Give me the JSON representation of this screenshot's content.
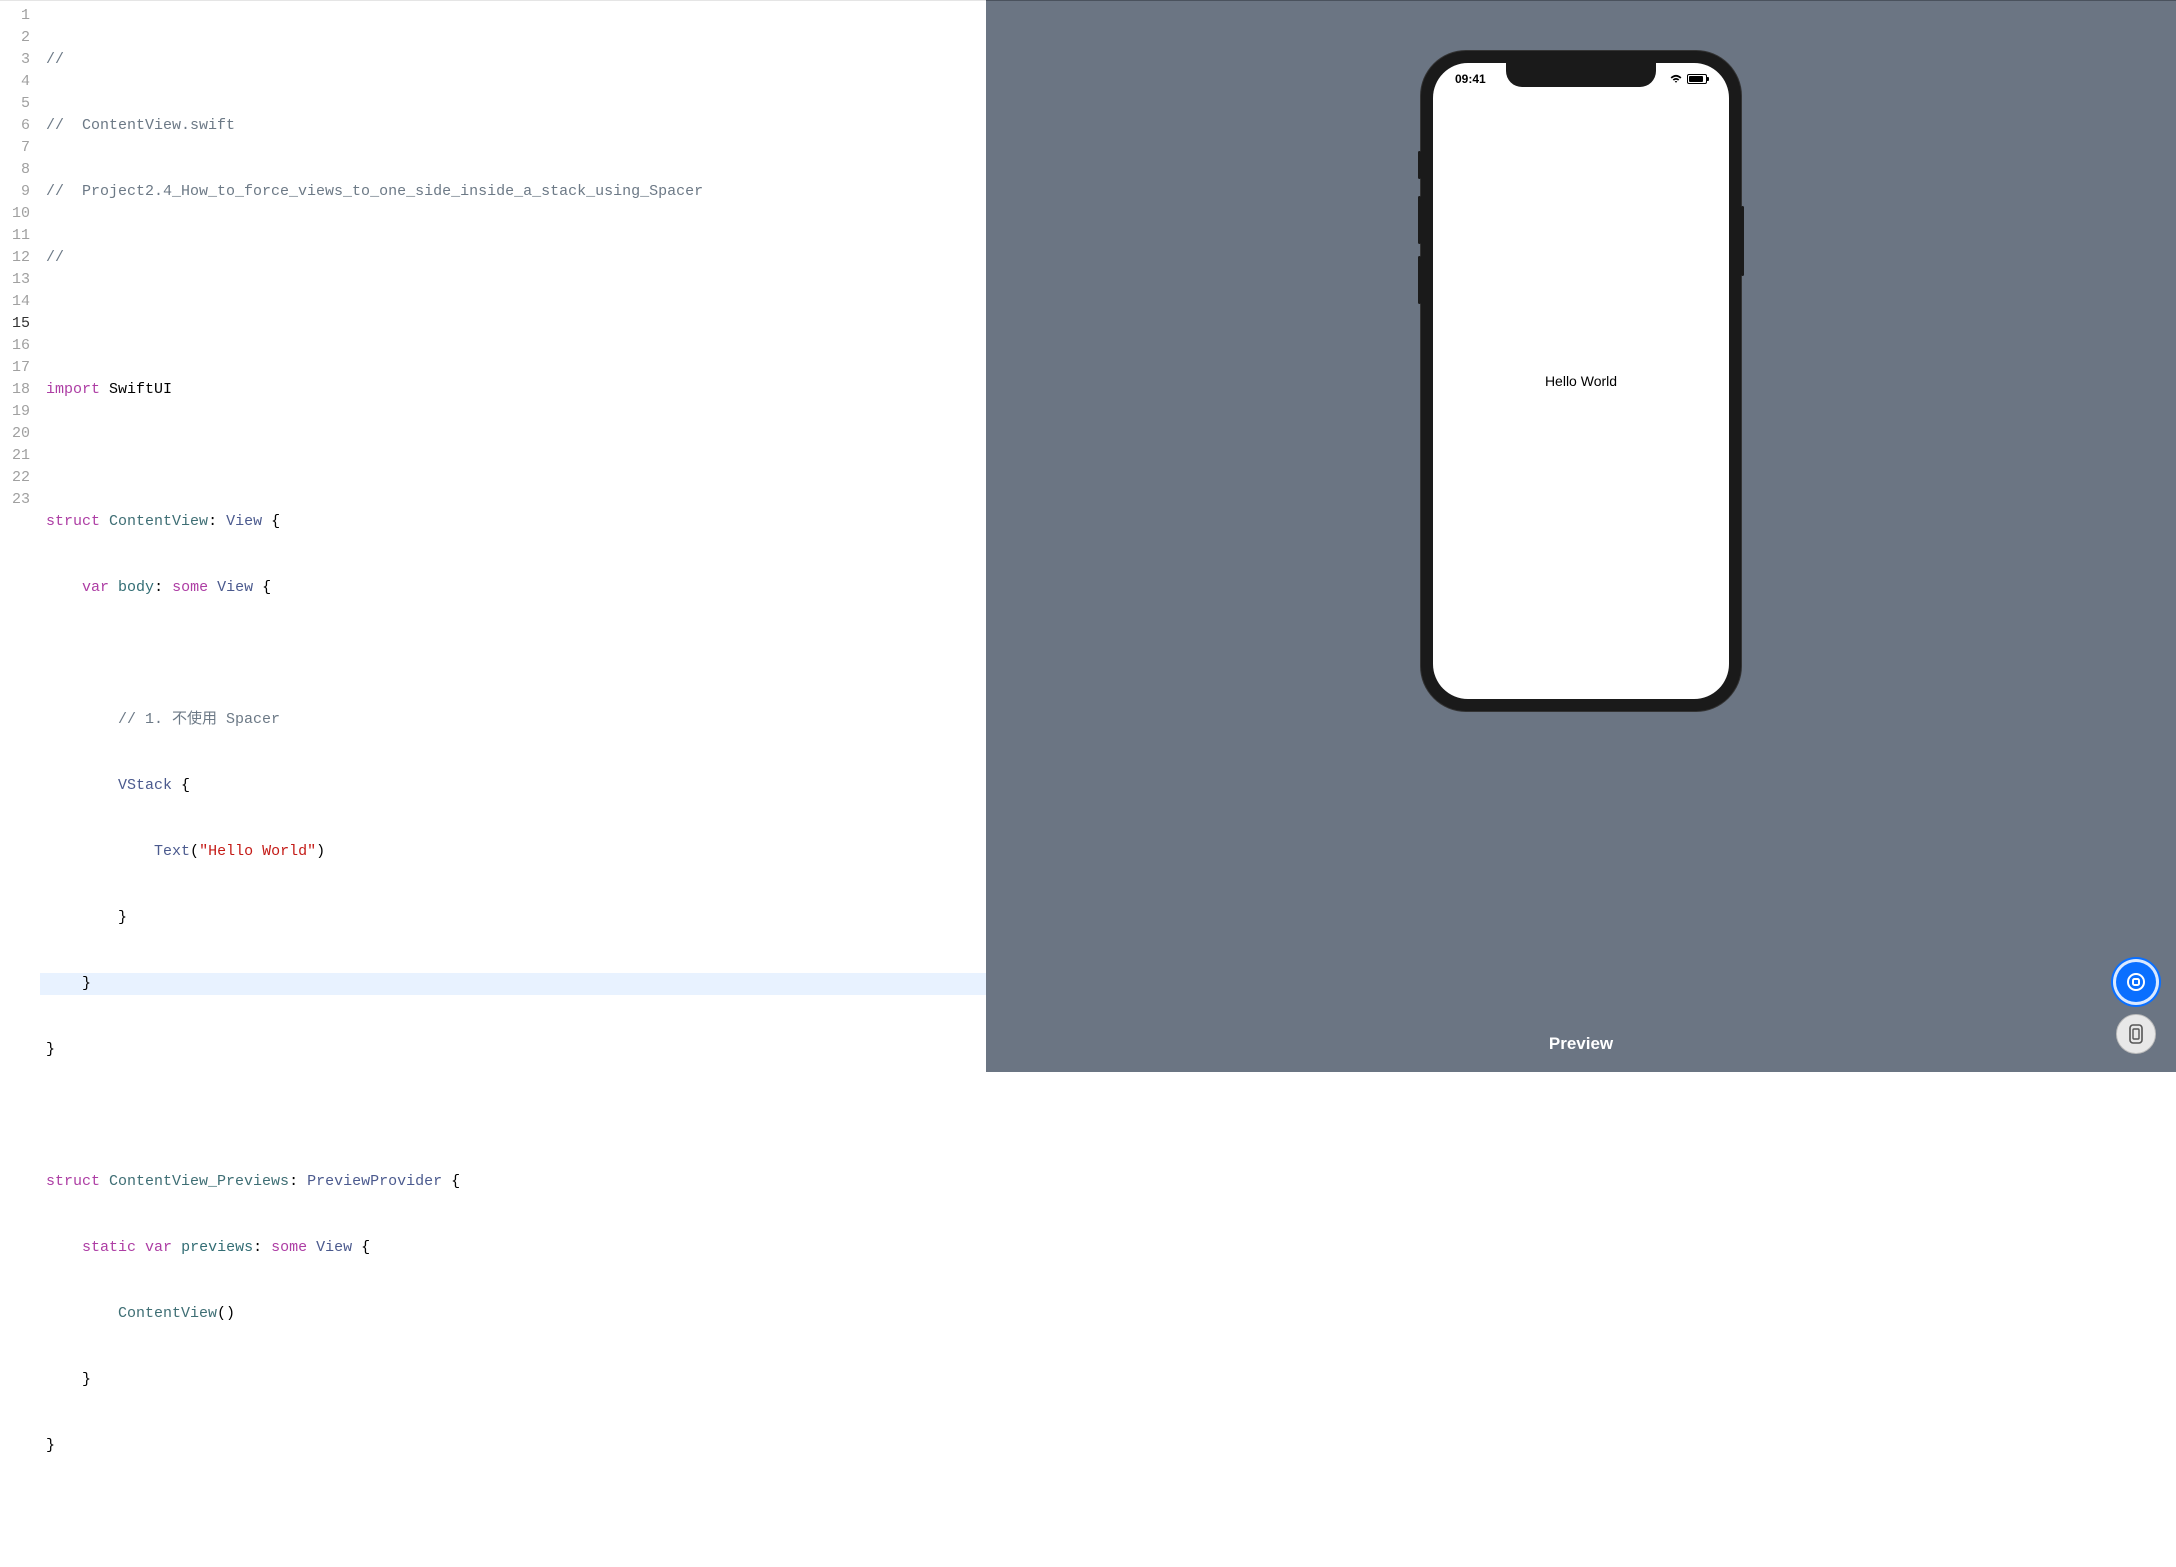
{
  "editor": {
    "line_count": 23,
    "current_line": 15,
    "lines": {
      "l1_comment": "//",
      "l2_comment1": "//  ",
      "l2_filename": "ContentView.swift",
      "l3_comment1": "//  ",
      "l3_project": "Project2.4_How_to_force_views_to_one_side_inside_a_stack_using_Spacer",
      "l4_comment": "//",
      "l6_import": "import",
      "l6_module": "SwiftUI",
      "l8_struct": "struct",
      "l8_name": "ContentView",
      "l8_colon": ": ",
      "l8_proto": "View",
      "l8_brace": " {",
      "l9_var": "var",
      "l9_body": "body",
      "l9_colon": ": ",
      "l9_some": "some",
      "l9_view": "View",
      "l9_brace": " {",
      "l11_comment": "// 1. 不使用 Spacer",
      "l12_vstack": "VStack",
      "l12_brace": " {",
      "l13_text": "Text",
      "l13_paren_open": "(",
      "l13_string": "\"Hello World\"",
      "l13_paren_close": ")",
      "l14_brace": "}",
      "l15_brace": "}",
      "l16_brace": "}",
      "l18_struct": "struct",
      "l18_name": "ContentView_Previews",
      "l18_colon": ": ",
      "l18_proto": "PreviewProvider",
      "l18_brace": " {",
      "l19_static": "static",
      "l19_var": "var",
      "l19_previews": "previews",
      "l19_colon": ": ",
      "l19_some": "some",
      "l19_view": "View",
      "l19_brace": " {",
      "l20_call": "ContentView",
      "l20_parens": "()",
      "l21_brace": "}",
      "l22_brace": "}"
    }
  },
  "preview": {
    "status_time": "09:41",
    "screen_text": "Hello World",
    "label": "Preview"
  }
}
